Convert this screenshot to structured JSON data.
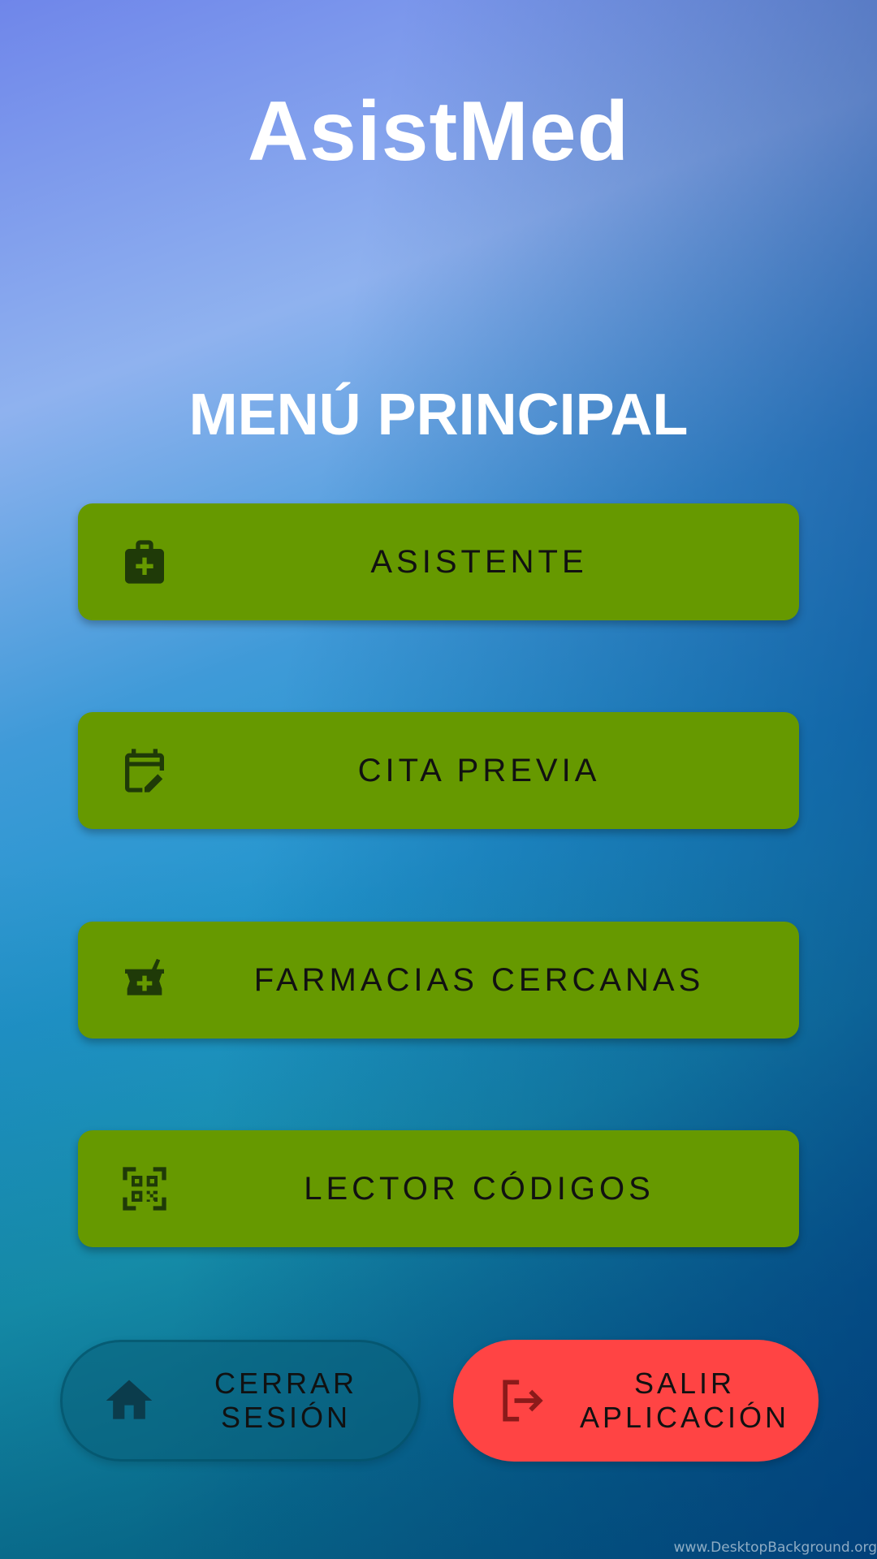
{
  "app": {
    "title": "AsistMed"
  },
  "menu": {
    "title": "MENÚ PRINCIPAL",
    "items": [
      {
        "label": "ASISTENTE",
        "icon": "medical-bag-icon"
      },
      {
        "label": "CITA PREVIA",
        "icon": "calendar-edit-icon"
      },
      {
        "label": "FARMACIAS CERCANAS",
        "icon": "mortar-pestle-plus-icon"
      },
      {
        "label": "LECTOR CÓDIGOS",
        "icon": "qr-code-scan-icon"
      }
    ]
  },
  "footer": {
    "logout": {
      "line1": "CERRAR",
      "line2": "SESIÓN",
      "icon": "home-icon"
    },
    "exit": {
      "line1": "SALIR",
      "line2": "APLICACIÓN",
      "icon": "exit-icon"
    }
  },
  "watermark": "www.DesktopBackground.org",
  "colors": {
    "menu_button": "#669900",
    "exit_button": "#ff4444",
    "icon_dark": "#1f3a08"
  }
}
